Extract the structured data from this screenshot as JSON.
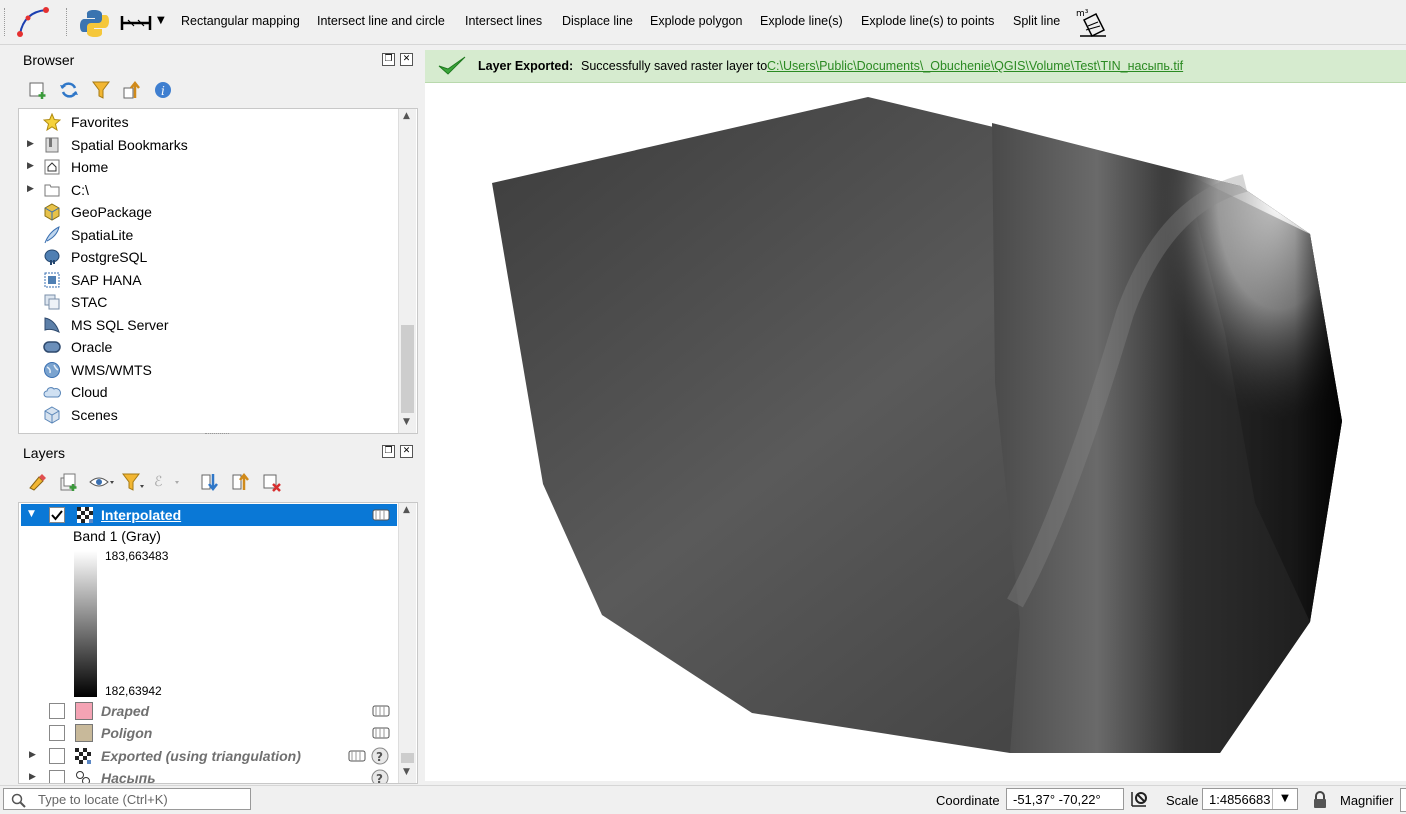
{
  "toolbar": {
    "items": [
      {
        "label": "Rectangular mapping"
      },
      {
        "label": "Intersect line and circle"
      },
      {
        "label": "Intersect lines"
      },
      {
        "label": "Displace line"
      },
      {
        "label": "Explode polygon"
      },
      {
        "label": "Explode line(s)"
      },
      {
        "label": "Explode line(s) to points"
      },
      {
        "label": "Split line"
      }
    ]
  },
  "browser": {
    "title": "Browser",
    "items": [
      {
        "label": "Favorites",
        "icon": "star-icon"
      },
      {
        "label": "Spatial Bookmarks",
        "icon": "bookmark-icon"
      },
      {
        "label": "Home",
        "icon": "home-icon"
      },
      {
        "label": "C:\\",
        "icon": "folder-icon"
      },
      {
        "label": "GeoPackage",
        "icon": "geopackage-icon"
      },
      {
        "label": "SpatiaLite",
        "icon": "feather-icon"
      },
      {
        "label": "PostgreSQL",
        "icon": "elephant-icon"
      },
      {
        "label": "SAP HANA",
        "icon": "hana-icon"
      },
      {
        "label": "STAC",
        "icon": "stac-icon"
      },
      {
        "label": "MS SQL Server",
        "icon": "mssql-icon"
      },
      {
        "label": "Oracle",
        "icon": "oracle-icon"
      },
      {
        "label": "WMS/WMTS",
        "icon": "globe-icon"
      },
      {
        "label": "Cloud",
        "icon": "cloud-icon"
      },
      {
        "label": "Scenes",
        "icon": "cube-icon"
      }
    ]
  },
  "layers": {
    "title": "Layers",
    "interpolated": {
      "name": "Interpolated",
      "band": "Band 1 (Gray)",
      "max": "183,663483",
      "min": "182,63942"
    },
    "draped": {
      "name": "Draped",
      "color": "#f4a3b4"
    },
    "poligon": {
      "name": "Poligon",
      "color": "#c8b99a"
    },
    "exported": {
      "name": "Exported (using triangulation)"
    },
    "nasyp": {
      "name": "Насыпь"
    }
  },
  "message": {
    "bold": "Layer Exported:",
    "text": "Successfully saved raster layer to",
    "link": "C:\\Users\\Public\\Documents\\_Obuchenie\\QGIS\\Volume\\Test\\TIN_насыпь.tif"
  },
  "status": {
    "locate_placeholder": "Type to locate (Ctrl+K)",
    "coordinate_label": "Coordinate",
    "coordinate_value": "-51,37°  -70,22°",
    "scale_label": "Scale",
    "scale_value": "1:4856683",
    "magnifier_label": "Magnifier"
  }
}
